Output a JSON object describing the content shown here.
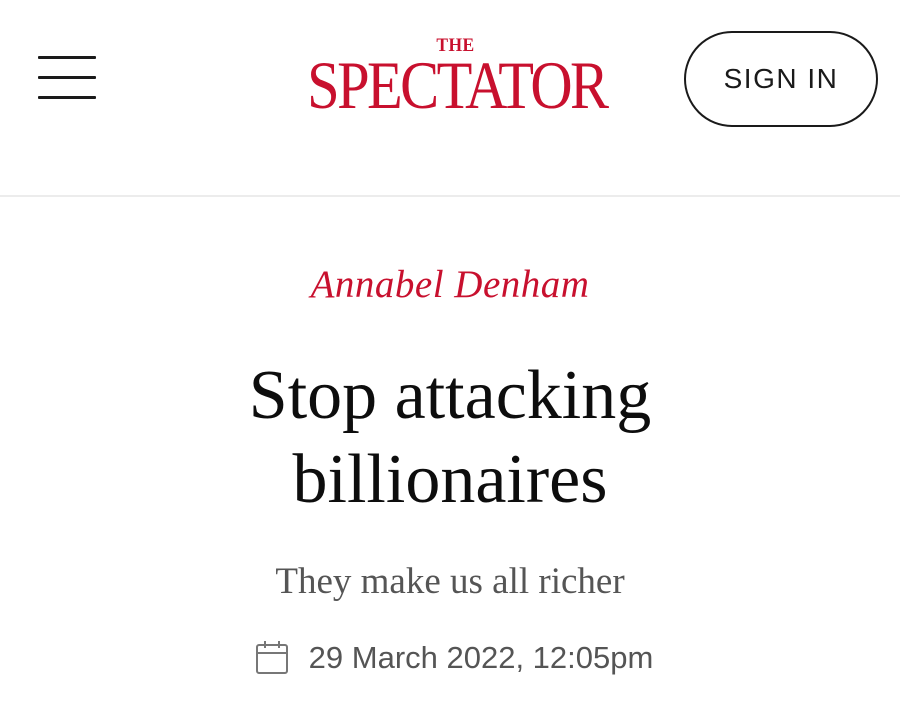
{
  "header": {
    "menu_icon": "hamburger-menu-icon",
    "logo": {
      "the": "THE",
      "word": "SPECTATOR",
      "color": "#c8102e"
    },
    "signin_label": "SIGN IN"
  },
  "article": {
    "author": "Annabel Denham",
    "title_line1": "Stop attacking",
    "title_line2": "billionaires",
    "standfirst": "They make us all richer",
    "date_icon": "calendar-icon",
    "date": "29 March 2022, 12:05pm"
  },
  "colors": {
    "accent": "#c8102e",
    "text": "#0d0d0d",
    "muted": "#555555",
    "divider": "#ececec"
  }
}
